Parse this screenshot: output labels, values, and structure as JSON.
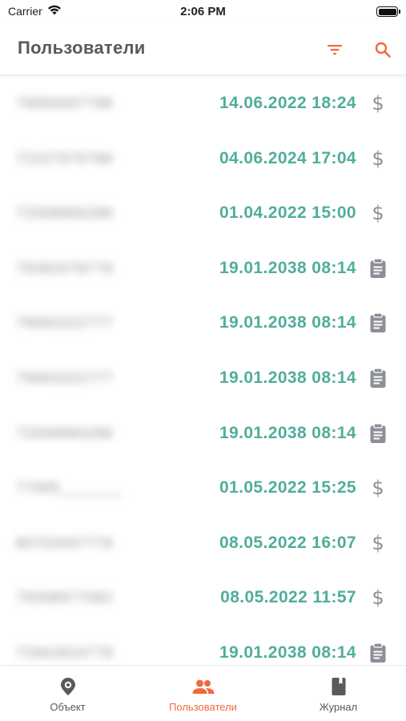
{
  "status": {
    "carrier": "Carrier",
    "time": "2:06 PM"
  },
  "header": {
    "title": "Пользователи"
  },
  "rows": [
    {
      "name": "79050007788",
      "date": "14.06.2022 18:24",
      "icon": "dollar-icon"
    },
    {
      "name": "72227070788",
      "date": "04.06.2024 17:04",
      "icon": "dollar-icon"
    },
    {
      "name": "72008906288",
      "date": "01.04.2022 15:00",
      "icon": "dollar-icon"
    },
    {
      "name": "79382078778",
      "date": "19.01.2038 08:14",
      "icon": "clipboard-icon"
    },
    {
      "name": "79993322777",
      "date": "19.01.2038 08:14",
      "icon": "clipboard-icon"
    },
    {
      "name": "79993322777",
      "date": "19.01.2038 08:14",
      "icon": "clipboard-icon"
    },
    {
      "name": "72008980288",
      "date": "19.01.2038 08:14",
      "icon": "clipboard-icon"
    },
    {
      "name": "77005_______",
      "date": "01.05.2022 15:25",
      "icon": "dollar-icon"
    },
    {
      "name": "80703497778",
      "date": "08.05.2022 16:07",
      "icon": "dollar-icon"
    },
    {
      "name": "79308977082",
      "date": "08.05.2022 11:57",
      "icon": "dollar-icon"
    },
    {
      "name": "72942824778",
      "date": "19.01.2038 08:14",
      "icon": "clipboard-icon"
    }
  ],
  "tabs": [
    {
      "label": "Объект",
      "icon": "location-pin-icon",
      "active": false
    },
    {
      "label": "Пользователи",
      "icon": "users-icon",
      "active": true
    },
    {
      "label": "Журнал",
      "icon": "journal-book-icon",
      "active": false
    }
  ],
  "colors": {
    "accent": "#ef6b3c",
    "date": "#4fae9a",
    "icon_gray": "#8c8f96"
  }
}
